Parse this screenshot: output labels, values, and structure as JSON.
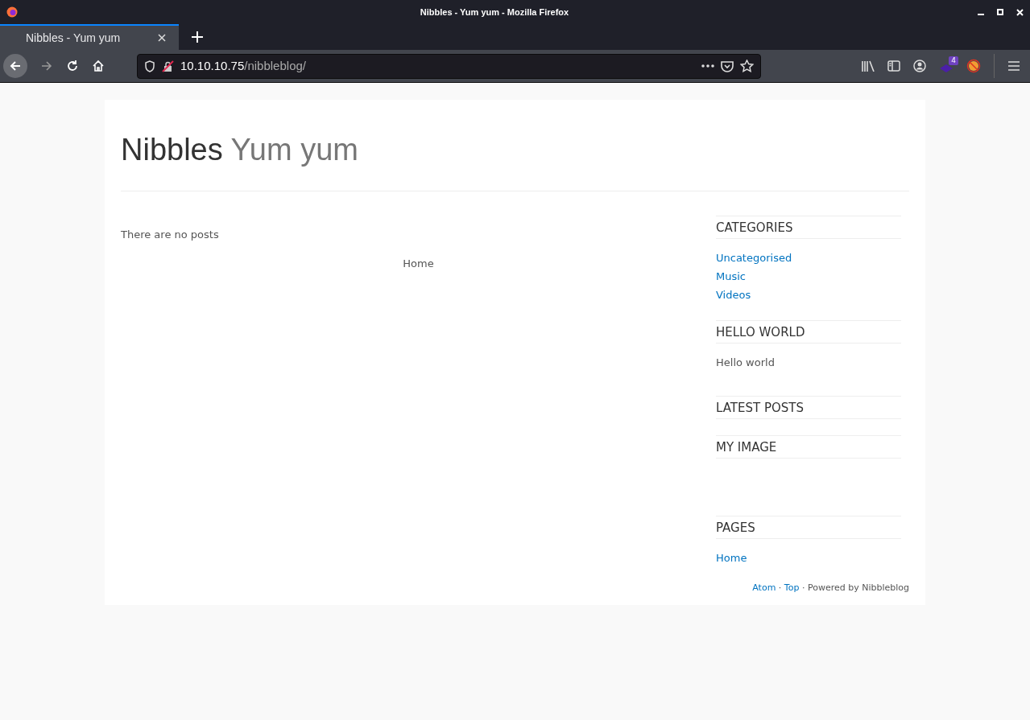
{
  "window": {
    "title": "Nibbles - Yum yum - Mozilla Firefox"
  },
  "tabs": [
    {
      "label": "Nibbles - Yum yum",
      "selected": true
    }
  ],
  "address_bar": {
    "host": "10.10.10.75",
    "path": "/nibbleblog/"
  },
  "extension_badge": "4",
  "blog": {
    "title": "Nibbles",
    "subtitle": "Yum yum"
  },
  "main": {
    "message": "There are no posts",
    "pager_link": "Home"
  },
  "sidebar": [
    {
      "title": "CATEGORIES",
      "kind": "links",
      "items": [
        "Uncategorised",
        "Music",
        "Videos"
      ]
    },
    {
      "title": "HELLO WORLD",
      "kind": "text",
      "body": "Hello world"
    },
    {
      "title": "LATEST POSTS",
      "kind": "empty"
    },
    {
      "title": "MY IMAGE",
      "kind": "image"
    },
    {
      "title": "PAGES",
      "kind": "links",
      "items": [
        "Home"
      ]
    }
  ],
  "footer": [
    {
      "kind": "link",
      "text": "Atom"
    },
    {
      "kind": "text",
      "text": "·"
    },
    {
      "kind": "link",
      "text": "Top"
    },
    {
      "kind": "text",
      "text": "· Powered by Nibbleblog"
    }
  ]
}
